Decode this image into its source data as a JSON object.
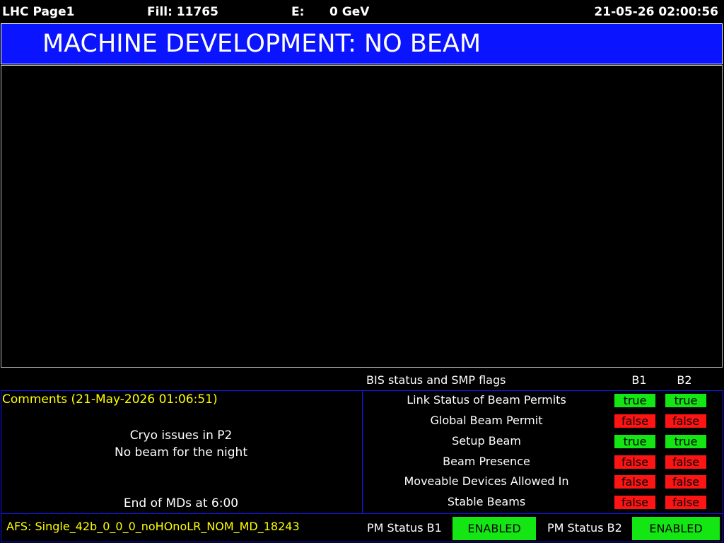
{
  "header": {
    "page_name": "LHC Page1",
    "fill_label": "Fill: 11765",
    "energy_label": "E:",
    "energy_value": "0 GeV",
    "datetime": "21-05-26 02:00:56"
  },
  "banner": {
    "mode": "MACHINE DEVELOPMENT: NO BEAM",
    "color": "#0a14ff"
  },
  "bis": {
    "title": "BIS status and SMP flags",
    "col_b1": "B1",
    "col_b2": "B2",
    "rows": [
      {
        "label": "Link Status of Beam Permits",
        "b1": "true",
        "b2": "true"
      },
      {
        "label": "Global Beam Permit",
        "b1": "false",
        "b2": "false"
      },
      {
        "label": "Setup Beam",
        "b1": "true",
        "b2": "true"
      },
      {
        "label": "Beam Presence",
        "b1": "false",
        "b2": "false"
      },
      {
        "label": "Moveable Devices Allowed In",
        "b1": "false",
        "b2": "false"
      },
      {
        "label": "Stable Beams",
        "b1": "false",
        "b2": "false"
      }
    ]
  },
  "comments": {
    "title": "Comments (21-May-2026 01:06:51)",
    "line1": "Cryo issues in P2",
    "line2": "No beam for the night",
    "line3": "End of MDs at 6:00"
  },
  "footer": {
    "afs": "AFS: Single_42b_0_0_0_noHOnoLR_NOM_MD_18243",
    "pm_b1_label": "PM Status B1",
    "pm_b1_value": "ENABLED",
    "pm_b2_label": "PM Status B2",
    "pm_b2_value": "ENABLED"
  },
  "colors": {
    "true": "#14e614",
    "false": "#ff1414",
    "comment_text": "#ffff00",
    "frame": "#1515ff"
  }
}
